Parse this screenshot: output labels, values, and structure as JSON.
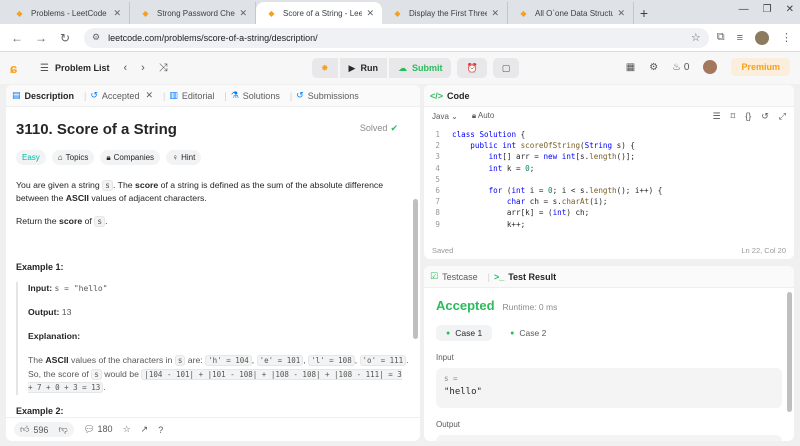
{
  "browser": {
    "tabs": [
      {
        "title": "Problems - LeetCode",
        "icon": "leetcode-icon",
        "active": false
      },
      {
        "title": "Strong Password Checke",
        "icon": "leetcode-icon",
        "active": false
      },
      {
        "title": "Score of a String - LeetC",
        "icon": "leetcode-icon",
        "active": true
      },
      {
        "title": "Display the First Three R",
        "icon": "leetcode-icon",
        "active": false
      },
      {
        "title": "All O`one Data Structure",
        "icon": "leetcode-icon",
        "active": false
      }
    ],
    "url": "leetcode.com/problems/score-of-a-string/description/"
  },
  "header": {
    "problem_list_label": "Problem List",
    "run_label": "Run",
    "submit_label": "Submit",
    "streak_count": "0",
    "premium_label": "Premium"
  },
  "left": {
    "tabs": {
      "description": "Description",
      "accepted": "Accepted",
      "editorial": "Editorial",
      "solutions": "Solutions",
      "submissions": "Submissions"
    },
    "title": "3110. Score of a String",
    "solved_label": "Solved",
    "tags": {
      "difficulty": "Easy",
      "topics": "Topics",
      "companies": "Companies",
      "hint": "Hint"
    },
    "desc": {
      "p1_a": "You are given a string ",
      "p1_code": "s",
      "p1_b": ". The ",
      "p1_bold1": "score",
      "p1_c": " of a string is defined as the sum of the absolute difference between the ",
      "p1_bold2": "ASCII",
      "p1_d": " values of adjacent characters.",
      "p2_a": "Return the ",
      "p2_bold": "score",
      "p2_b": " of ",
      "p2_code": "s",
      "p2_c": "."
    },
    "example1": {
      "heading": "Example 1:",
      "input_label": "Input:",
      "input_value": "s = \"hello\"",
      "output_label": "Output:",
      "output_value": "13",
      "explanation_label": "Explanation:",
      "exp_a": "The ",
      "exp_bold": "ASCII",
      "exp_b": " values of the characters in ",
      "exp_code_s": "s",
      "exp_c": " are: ",
      "exp_h": "'h' = 104",
      "exp_e": "'e' = 101",
      "exp_l": "'l' = 108",
      "exp_o": "'o' = 111",
      "exp_d": ". So, the score of ",
      "exp_code_s2": "s",
      "exp_e2": " would be ",
      "exp_formula1": "|104 - 101| + |101 - 108| + |108 - 108| + |108 - 111| = 3 + 7 + 0 + 3 = 13",
      "exp_end": "."
    },
    "example2": {
      "heading": "Example 2:"
    },
    "bottom": {
      "likes": "596",
      "comments": "180"
    }
  },
  "code": {
    "tab_label": "Code",
    "language": "Java",
    "mode": "Auto",
    "lines": [
      {
        "n": "1",
        "html": "<span class='kw'>class</span> <span class='ty'>Solution</span> {"
      },
      {
        "n": "2",
        "html": "    <span class='kw'>public</span> <span class='ty'>int</span> <span class='fn'>scoreOfString</span>(<span class='ty'>String</span> s) {"
      },
      {
        "n": "3",
        "html": "        <span class='ty'>int</span>[] arr = <span class='kw'>new</span> <span class='ty'>int</span>[s.<span class='fn'>length</span>()];"
      },
      {
        "n": "4",
        "html": "        <span class='ty'>int</span> k = <span class='num'>0</span>;"
      },
      {
        "n": "5",
        "html": ""
      },
      {
        "n": "6",
        "html": "        <span class='kw'>for</span> (<span class='ty'>int</span> i = <span class='num'>0</span>; i &lt; s.<span class='fn'>length</span>(); i++) {"
      },
      {
        "n": "7",
        "html": "            <span class='ty'>char</span> ch = s.<span class='fn'>charAt</span>(i);"
      },
      {
        "n": "8",
        "html": "            arr[k] = (<span class='ty'>int</span>) ch;"
      },
      {
        "n": "9",
        "html": "            k++;"
      }
    ],
    "saved_label": "Saved",
    "cursor_pos": "Ln 22, Col 20"
  },
  "result": {
    "tabs": {
      "testcase": "Testcase",
      "test_result": "Test Result"
    },
    "status": "Accepted",
    "runtime": "Runtime: 0 ms",
    "cases": [
      "Case 1",
      "Case 2"
    ],
    "input_label": "Input",
    "input_var": "s =",
    "input_value": "\"hello\"",
    "output_label": "Output"
  }
}
